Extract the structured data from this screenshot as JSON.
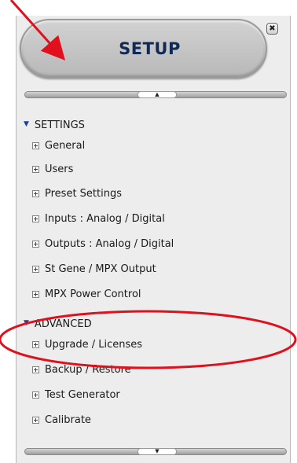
{
  "setup_title": "SETUP",
  "close_glyph": "✖",
  "scroll_up_glyph": "▲",
  "scroll_down_glyph": "▼",
  "sections": [
    {
      "title": "SETTINGS",
      "items": [
        "General",
        "Users",
        "Preset Settings",
        "Inputs : Analog / Digital",
        "Outputs : Analog / Digital",
        "St Gene / MPX Output",
        "MPX Power Control"
      ]
    },
    {
      "title": "ADVANCED",
      "items": [
        "Upgrade / Licenses",
        "Backup / Restore",
        "Test Generator",
        "Calibrate"
      ]
    }
  ],
  "colors": {
    "annotation": "#e0101c",
    "triangle": "#1b3fa6",
    "panel_bg": "#ededed"
  }
}
